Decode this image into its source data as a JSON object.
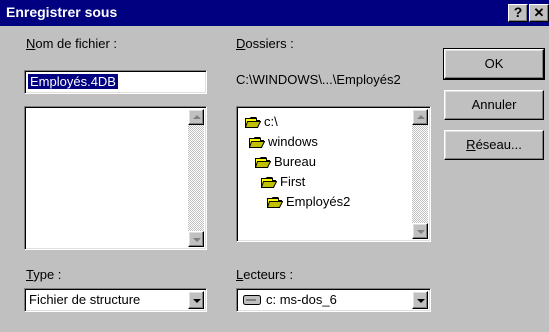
{
  "window": {
    "title": "Enregistrer sous",
    "help_label": "?",
    "close_label": "✕"
  },
  "file_name": {
    "label_accel": "N",
    "label_rest": "om de fichier :",
    "value": "Employés.4DB"
  },
  "folders": {
    "label_accel": "D",
    "label_rest": "ossiers :",
    "current_path": "C:\\WINDOWS\\...\\Employés2",
    "items": [
      {
        "label": "c:\\",
        "icon": "open-folder-icon"
      },
      {
        "label": "windows",
        "icon": "open-folder-icon"
      },
      {
        "label": "Bureau",
        "icon": "open-folder-icon"
      },
      {
        "label": "First",
        "icon": "open-folder-icon"
      },
      {
        "label": "Employés2",
        "icon": "open-folder-icon"
      }
    ]
  },
  "file_type": {
    "label_accel": "T",
    "label_rest": "ype :",
    "selected": "Fichier de structure"
  },
  "drives": {
    "label_accel": "L",
    "label_rest": "ecteurs :",
    "selected": "c: ms-dos_6",
    "icon": "drive-icon"
  },
  "buttons": {
    "ok": "OK",
    "cancel": "Annuler",
    "network_accel": "R",
    "network_rest": "éseau..."
  },
  "colors": {
    "titlebar": "#000080",
    "face": "#c0c0c0",
    "selection": "#000080",
    "folder": "#ffff00"
  }
}
